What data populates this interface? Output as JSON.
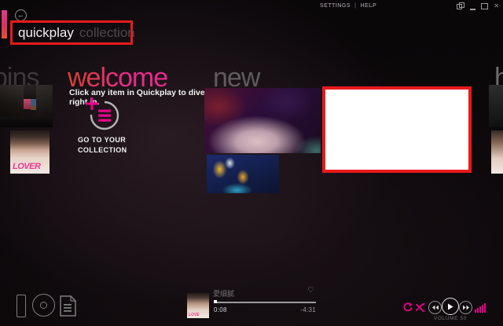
{
  "app": {
    "accent_pink": "#ec008c",
    "highlight_red": "#e8191c"
  },
  "titlebar": {
    "settings": "SETTINGS",
    "divider": "|",
    "help": "HELP"
  },
  "icons": {
    "back": "←",
    "close": "✕",
    "heart": "♡"
  },
  "header": {
    "title_primary": "quickplay",
    "title_secondary": "collection"
  },
  "pins": {
    "heading": "pins",
    "album_text": "LOVER"
  },
  "welcome": {
    "heading": "welcome",
    "subtitle": "Click any item in Quickplay to dive right in.",
    "button": "GO TO YOUR COLLECTION"
  },
  "new_section": {
    "heading": "new"
  },
  "history": {
    "heading_partial": "h"
  },
  "player": {
    "track_title": "愛細膩",
    "elapsed": "0:08",
    "remaining": "-4:31",
    "volume": "VOLUME 50",
    "album_text": "LOVE"
  }
}
